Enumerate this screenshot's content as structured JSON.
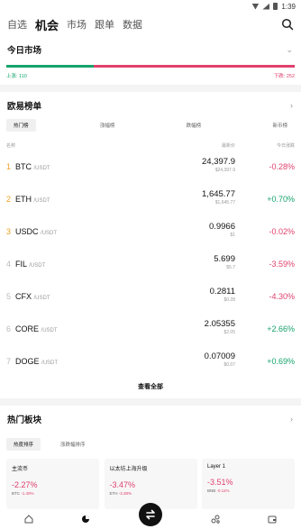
{
  "statusbar": {
    "time": "1:39"
  },
  "topnav": {
    "tabs": [
      {
        "label": "自选"
      },
      {
        "label": "机会"
      },
      {
        "label": "市场"
      },
      {
        "label": "跟单"
      },
      {
        "label": "数据"
      }
    ],
    "active_index": 1
  },
  "today_market": {
    "title": "今日市场",
    "up_label": "上涨: 110",
    "down_label": "下跌: 252",
    "up_count": 110,
    "down_count": 252
  },
  "rankings": {
    "title": "欧易榜单",
    "tabs": [
      {
        "label": "热门榜"
      },
      {
        "label": "涨幅榜"
      },
      {
        "label": "跌幅榜"
      },
      {
        "label": "新币榜"
      }
    ],
    "columns": {
      "name": "名称",
      "price": "最新价",
      "change": "今日涨跌"
    },
    "rows": [
      {
        "rank": "1",
        "base": "BTC",
        "quote": "/USDT",
        "price": "24,397.9",
        "fiat": "$24,397.9",
        "change": "-0.28%",
        "dir": "down"
      },
      {
        "rank": "2",
        "base": "ETH",
        "quote": "/USDT",
        "price": "1,645.77",
        "fiat": "$1,645.77",
        "change": "+0.70%",
        "dir": "up"
      },
      {
        "rank": "3",
        "base": "USDC",
        "quote": "/USDT",
        "price": "0.9966",
        "fiat": "$1",
        "change": "-0.02%",
        "dir": "down"
      },
      {
        "rank": "4",
        "base": "FIL",
        "quote": "/USDT",
        "price": "5.699",
        "fiat": "$5.7",
        "change": "-3.59%",
        "dir": "down"
      },
      {
        "rank": "5",
        "base": "CFX",
        "quote": "/USDT",
        "price": "0.2811",
        "fiat": "$0.28",
        "change": "-4.30%",
        "dir": "down"
      },
      {
        "rank": "6",
        "base": "CORE",
        "quote": "/USDT",
        "price": "2.05355",
        "fiat": "$2.05",
        "change": "+2.66%",
        "dir": "up"
      },
      {
        "rank": "7",
        "base": "DOGE",
        "quote": "/USDT",
        "price": "0.07009",
        "fiat": "$0.07",
        "change": "+0.69%",
        "dir": "up"
      }
    ],
    "view_all": "查看全部"
  },
  "sectors": {
    "title": "热门板块",
    "tabs": [
      {
        "label": "热度排序"
      },
      {
        "label": "涨跌幅排序"
      }
    ],
    "cards": [
      {
        "name": "主流币",
        "change": "-2.27%",
        "top_symbol": "BTC",
        "top_change": "-1.40%"
      },
      {
        "name": "以太坊上海升级",
        "change": "-3.47%",
        "top_symbol": "ETH",
        "top_change": "-3.38%"
      },
      {
        "name": "Layer 1",
        "change": "-3.51%",
        "top_symbol": "BNB",
        "top_change": "-0.11%"
      }
    ]
  },
  "colors": {
    "up": "#16a36c",
    "down": "#e0416e"
  }
}
